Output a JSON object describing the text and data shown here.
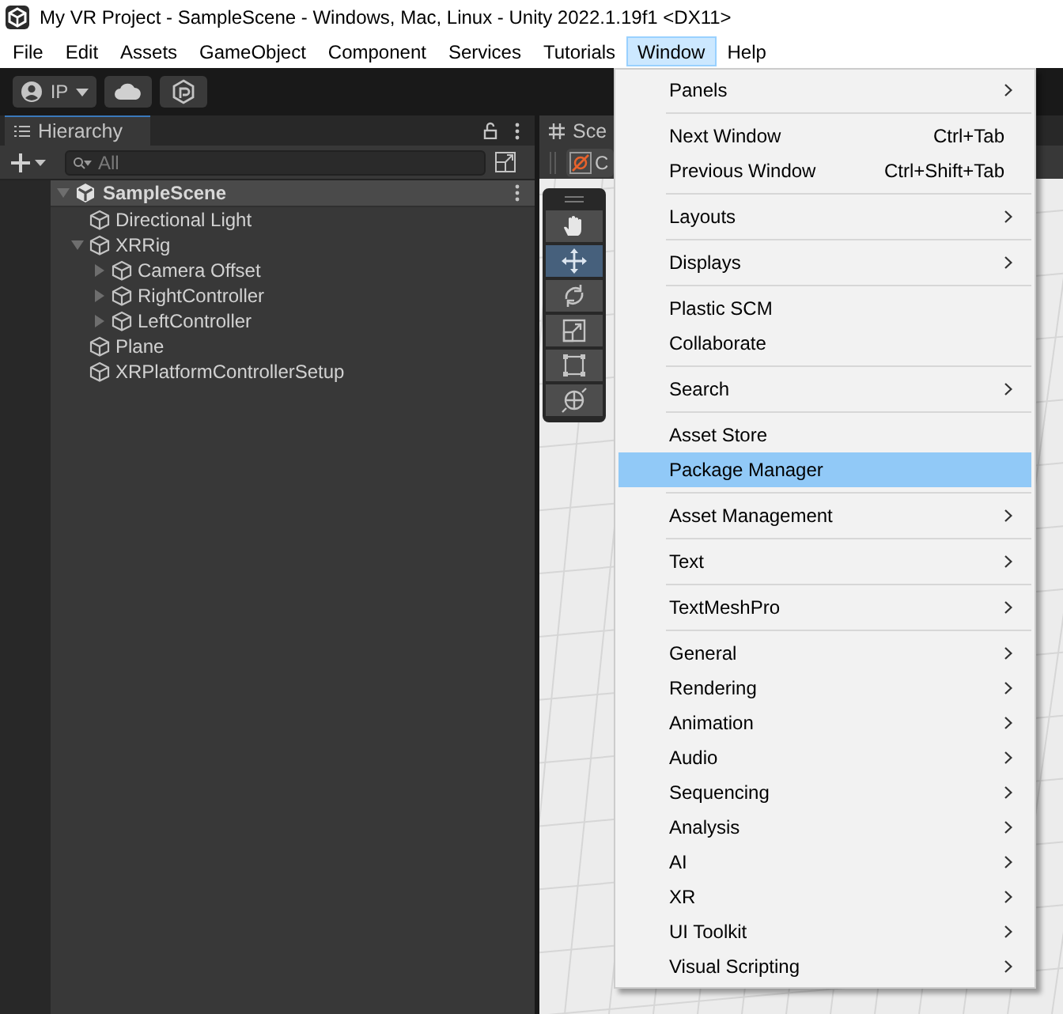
{
  "window": {
    "title": "My VR Project - SampleScene - Windows, Mac, Linux - Unity 2022.1.19f1 <DX11>"
  },
  "menu_bar": [
    {
      "label": "File",
      "selected": false
    },
    {
      "label": "Edit",
      "selected": false
    },
    {
      "label": "Assets",
      "selected": false
    },
    {
      "label": "GameObject",
      "selected": false
    },
    {
      "label": "Component",
      "selected": false
    },
    {
      "label": "Services",
      "selected": false
    },
    {
      "label": "Tutorials",
      "selected": false
    },
    {
      "label": "Window",
      "selected": true
    },
    {
      "label": "Help",
      "selected": false
    }
  ],
  "toolbar": {
    "account": "IP"
  },
  "hierarchy": {
    "title": "Hierarchy",
    "search": {
      "placeholder": "All"
    },
    "scene": {
      "name": "SampleScene",
      "expanded": true
    },
    "items": [
      {
        "name": "Directional Light"
      },
      {
        "name": "XRRig",
        "expanded": true,
        "children": [
          {
            "name": "Camera Offset",
            "expanded": false
          },
          {
            "name": "RightController",
            "expanded": false
          },
          {
            "name": "LeftController",
            "expanded": false
          }
        ]
      },
      {
        "name": "Plane"
      },
      {
        "name": "XRPlatformControllerSetup"
      }
    ]
  },
  "scene_view": {
    "tab": "Sce",
    "toolbar_text": "C",
    "tools": [
      {
        "kind": "hand",
        "selected": false
      },
      {
        "kind": "move",
        "selected": true
      },
      {
        "kind": "rotate",
        "selected": false
      },
      {
        "kind": "scale",
        "selected": false
      },
      {
        "kind": "rect",
        "selected": false
      },
      {
        "kind": "transform",
        "selected": false
      }
    ]
  },
  "window_menu": [
    [
      {
        "label": "Panels",
        "submenu": true,
        "selected": false
      }
    ],
    [
      {
        "label": "Next Window",
        "shortcut": "Ctrl+Tab",
        "submenu": false,
        "selected": false
      },
      {
        "label": "Previous Window",
        "shortcut": "Ctrl+Shift+Tab",
        "submenu": false,
        "selected": false
      }
    ],
    [
      {
        "label": "Layouts",
        "submenu": true,
        "selected": false
      }
    ],
    [
      {
        "label": "Displays",
        "submenu": true,
        "selected": false
      }
    ],
    [
      {
        "label": "Plastic SCM",
        "submenu": false,
        "selected": false
      },
      {
        "label": "Collaborate",
        "submenu": false,
        "selected": false
      }
    ],
    [
      {
        "label": "Search",
        "submenu": true,
        "selected": false
      }
    ],
    [
      {
        "label": "Asset Store",
        "submenu": false,
        "selected": false
      },
      {
        "label": "Package Manager",
        "submenu": false,
        "selected": true
      }
    ],
    [
      {
        "label": "Asset Management",
        "submenu": true,
        "selected": false
      }
    ],
    [
      {
        "label": "Text",
        "submenu": true,
        "selected": false
      }
    ],
    [
      {
        "label": "TextMeshPro",
        "submenu": true,
        "selected": false
      }
    ],
    [
      {
        "label": "General",
        "submenu": true,
        "selected": false
      },
      {
        "label": "Rendering",
        "submenu": true,
        "selected": false
      },
      {
        "label": "Animation",
        "submenu": true,
        "selected": false
      },
      {
        "label": "Audio",
        "submenu": true,
        "selected": false
      },
      {
        "label": "Sequencing",
        "submenu": true,
        "selected": false
      },
      {
        "label": "Analysis",
        "submenu": true,
        "selected": false
      },
      {
        "label": "AI",
        "submenu": true,
        "selected": false
      },
      {
        "label": "XR",
        "submenu": true,
        "selected": false
      },
      {
        "label": "UI Toolkit",
        "submenu": true,
        "selected": false
      },
      {
        "label": "Visual Scripting",
        "submenu": true,
        "selected": false
      }
    ]
  ]
}
